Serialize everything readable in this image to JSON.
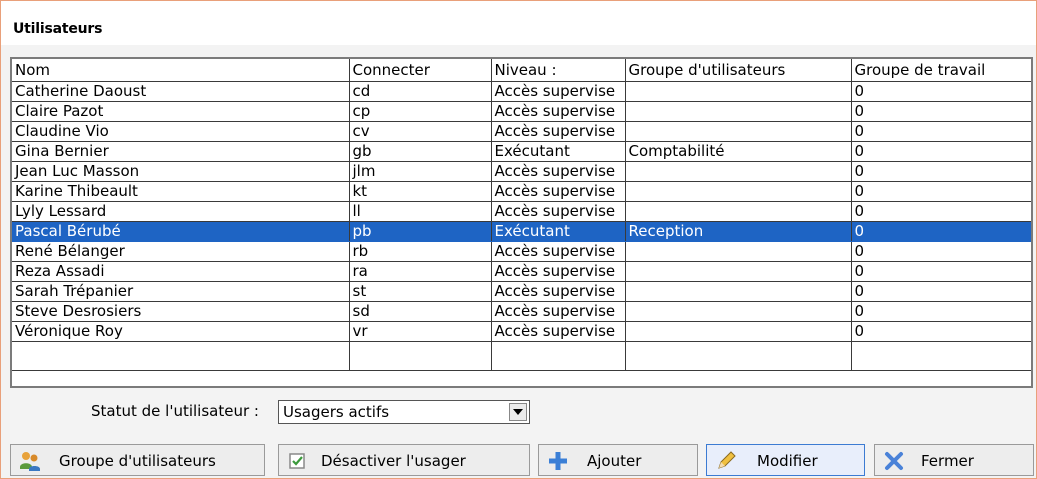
{
  "window": {
    "title": "Utilisateurs"
  },
  "grid": {
    "columns": [
      "Nom",
      "Connecter",
      "Niveau :",
      "Groupe d'utilisateurs",
      "Groupe de travail"
    ],
    "rows": [
      [
        "Catherine Daoust",
        "cd",
        "Accès supervise",
        "",
        "0"
      ],
      [
        "Claire Pazot",
        "cp",
        "Accès supervise",
        "",
        "0"
      ],
      [
        "Claudine Vio",
        "cv",
        "Accès supervise",
        "",
        "0"
      ],
      [
        "Gina Bernier",
        "gb",
        "Exécutant",
        "Comptabilité",
        "0"
      ],
      [
        "Jean Luc Masson",
        "jlm",
        "Accès supervise",
        "",
        "0"
      ],
      [
        "Karine Thibeault",
        "kt",
        "Accès supervise",
        "",
        "0"
      ],
      [
        "Lyly Lessard",
        "ll",
        "Accès supervise",
        "",
        "0"
      ],
      [
        "Pascal Bérubé",
        "pb",
        "Exécutant",
        "Reception",
        "0"
      ],
      [
        "René Bélanger",
        "rb",
        "Accès supervise",
        "",
        "0"
      ],
      [
        "Reza Assadi",
        "ra",
        "Accès supervise",
        "",
        "0"
      ],
      [
        "Sarah Trépanier",
        "st",
        "Accès supervise",
        "",
        "0"
      ],
      [
        "Steve Desrosiers",
        "sd",
        "Accès supervise",
        "",
        "0"
      ],
      [
        "Véronique Roy",
        "vr",
        "Accès supervise",
        "",
        "0"
      ]
    ],
    "selected_row": 7
  },
  "status": {
    "label": "Statut de l'utilisateur :",
    "value": "Usagers actifs"
  },
  "buttons": {
    "groups": {
      "label": "Groupe d'utilisateurs",
      "icon": "users-icon"
    },
    "deactivate": {
      "label": "Désactiver l'usager",
      "icon": "checkbox-icon"
    },
    "add": {
      "label": "Ajouter",
      "icon": "plus-icon"
    },
    "edit": {
      "label": "Modifier",
      "icon": "pencil-icon"
    },
    "close": {
      "label": "Fermer",
      "icon": "close-icon"
    }
  },
  "colors": {
    "selection": "#1e64c4",
    "window_border": "#e9a07a",
    "plus": "#3b7fd6",
    "close_x": "#4a82d8"
  }
}
